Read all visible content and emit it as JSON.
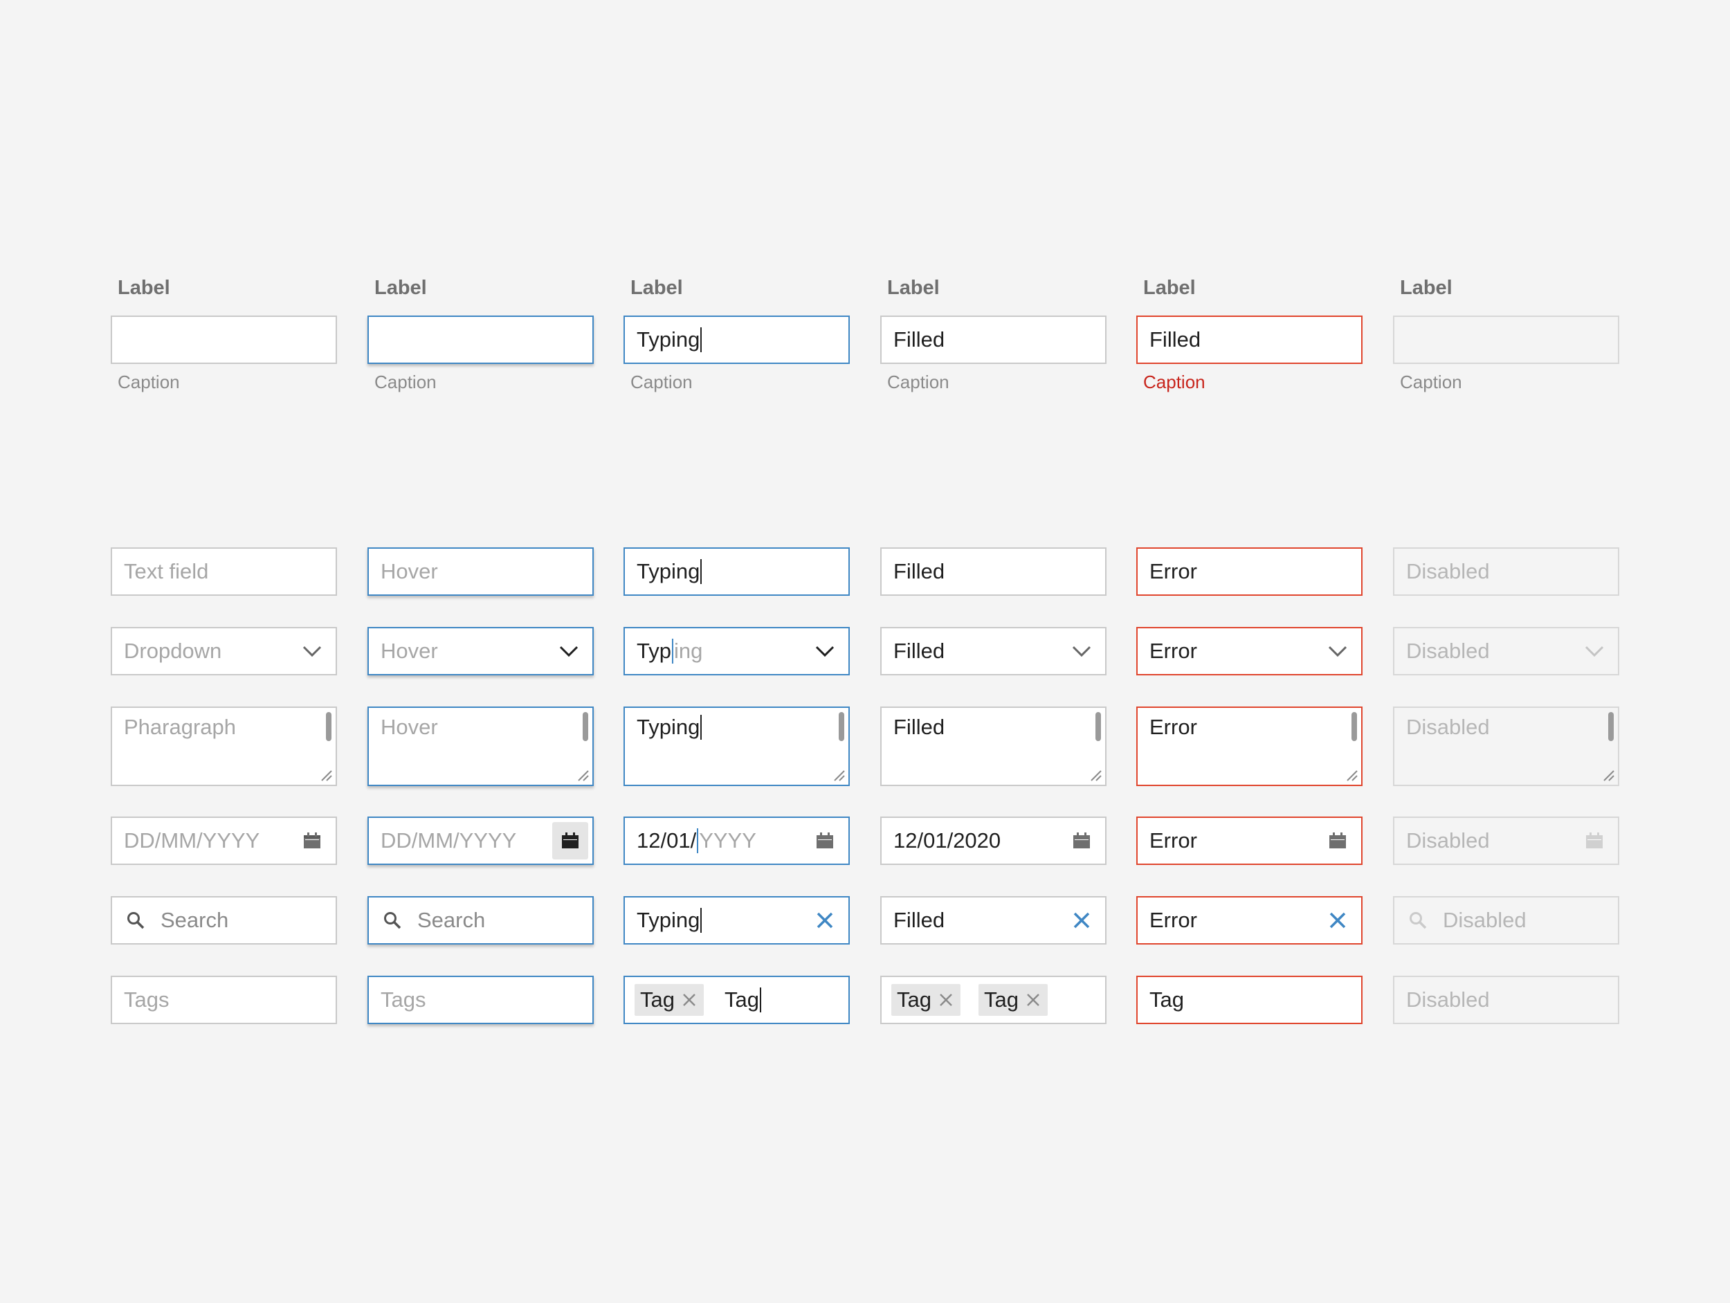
{
  "colors": {
    "background": "#f4f4f4",
    "border": "#c9c9c9",
    "focus_blue": "#3f87c4",
    "error_red": "#e0452d",
    "error_caption": "#c8251c",
    "placeholder": "#a6a6a6"
  },
  "columns": [
    {
      "state": "default",
      "label": "Label",
      "labeled_field": "",
      "caption": "Caption",
      "text_field": "Text field",
      "dropdown": "Dropdown",
      "paragraph": "Pharagraph",
      "date": "DD/MM/YYYY",
      "search": "Search",
      "tags_input": "Tags"
    },
    {
      "state": "hover",
      "label": "Label",
      "labeled_field": "",
      "caption": "Caption",
      "text_field": "Hover",
      "dropdown": "Hover",
      "paragraph": "Hover",
      "date": "DD/MM/YYYY",
      "search": "Search",
      "tags_input": "Tags"
    },
    {
      "state": "typing",
      "label": "Label",
      "labeled_field": "Typing",
      "caption": "Caption",
      "text_field": "Typing",
      "dropdown_typed": "Typ",
      "dropdown_hint": "ing",
      "paragraph": "Typing",
      "date_typed": "12/01/",
      "date_hint": "YYYY",
      "search": "Typing",
      "tags": [
        "Tag"
      ],
      "tags_input": "Tag"
    },
    {
      "state": "filled",
      "label": "Label",
      "labeled_field": "Filled",
      "caption": "Caption",
      "text_field": "Filled",
      "dropdown": "Filled",
      "paragraph": "Filled",
      "date": "12/01/2020",
      "search": "Filled",
      "tags": [
        "Tag",
        "Tag"
      ]
    },
    {
      "state": "error",
      "label": "Label",
      "labeled_field": "Filled",
      "caption": "Caption",
      "text_field": "Error",
      "dropdown": "Error",
      "paragraph": "Error",
      "date": "Error",
      "search": "Error",
      "tags_input": "Tag"
    },
    {
      "state": "disabled",
      "label": "Label",
      "labeled_field": "",
      "caption": "Caption",
      "text_field": "Disabled",
      "dropdown": "Disabled",
      "paragraph": "Disabled",
      "date": "Disabled",
      "search": "Disabled",
      "tags_input": "Disabled"
    }
  ],
  "icons": {
    "dropdown": "chevron-down-icon",
    "date": "calendar-icon",
    "search": "magnifier-icon",
    "clear": "close-icon",
    "tag_remove": "close-icon",
    "paragraph_resize": "resize-handle-icon"
  }
}
